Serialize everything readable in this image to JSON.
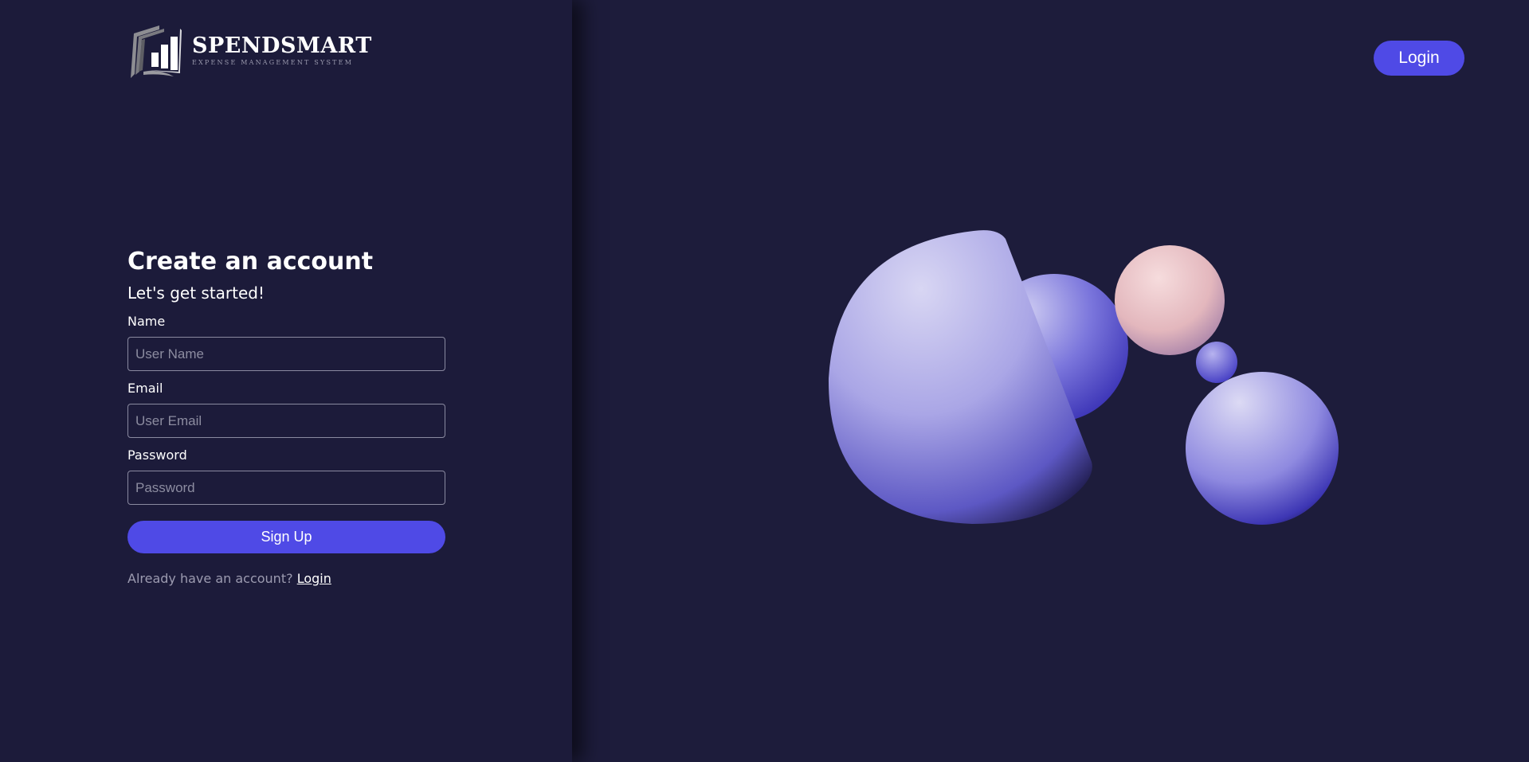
{
  "brand": {
    "name": "SPENDSMART",
    "tagline": "EXPENSE MANAGEMENT SYSTEM",
    "logo_icon": "bar-chart-book-icon"
  },
  "header": {
    "login_label": "Login"
  },
  "form": {
    "title": "Create an account",
    "subtitle": "Let's get started!",
    "name_label": "Name",
    "name_placeholder": "User Name",
    "name_value": "",
    "email_label": "Email",
    "email_placeholder": "User Email",
    "email_value": "",
    "password_label": "Password",
    "password_placeholder": "Password",
    "password_value": "",
    "submit_label": "Sign Up",
    "login_prompt": "Already have an account?",
    "login_link": "Login"
  },
  "colors": {
    "background": "#1c1b3a",
    "accent": "#4f4ae6",
    "text": "#ffffff",
    "muted_text": "#9c9bb0"
  }
}
